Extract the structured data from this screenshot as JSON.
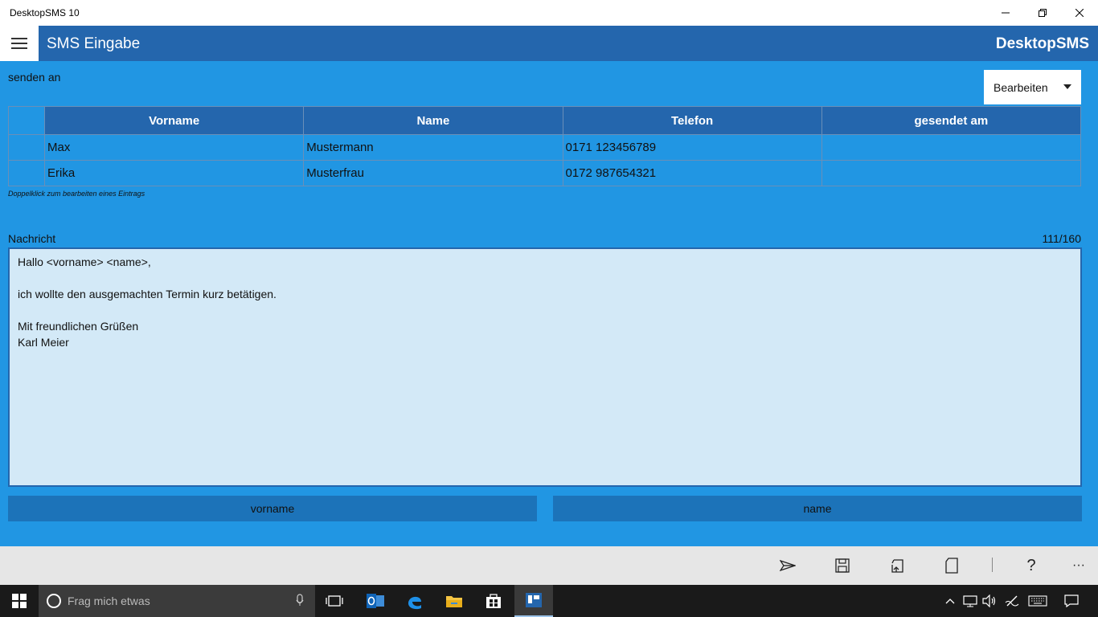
{
  "window": {
    "title": "DesktopSMS 10"
  },
  "header": {
    "page_title": "SMS Eingabe",
    "brand": "DesktopSMS"
  },
  "recipients": {
    "label": "senden an",
    "dropdown_value": "Bearbeiten",
    "columns": [
      "Vorname",
      "Name",
      "Telefon",
      "gesendet am"
    ],
    "rows": [
      {
        "vorname": "Max",
        "name": "Mustermann",
        "telefon": "0171 123456789",
        "gesendet": ""
      },
      {
        "vorname": "Erika",
        "name": "Musterfrau",
        "telefon": "0172 987654321",
        "gesendet": ""
      }
    ],
    "hint": "Doppelklick zum bearbeiten eines Eintrags"
  },
  "message": {
    "label": "Nachricht",
    "counter": "111/160",
    "text": "Hallo <vorname> <name>,\n\nich wollte den ausgemachten Termin kurz betätigen.\n\nMit freundlichen Grüßen\nKarl Meier"
  },
  "placeholders": {
    "vorname_label": "vorname",
    "name_label": "name"
  },
  "commands": {
    "send_icon": "send-icon",
    "save_icon": "save-icon",
    "export_icon": "export-icon",
    "page_icon": "page-icon",
    "help_label": "?",
    "more_label": "···"
  },
  "taskbar": {
    "search_placeholder": "Frag mich etwas"
  },
  "colors": {
    "accent": "#2196E3",
    "header": "#2466AD",
    "message_bg": "#D3E9F7"
  }
}
